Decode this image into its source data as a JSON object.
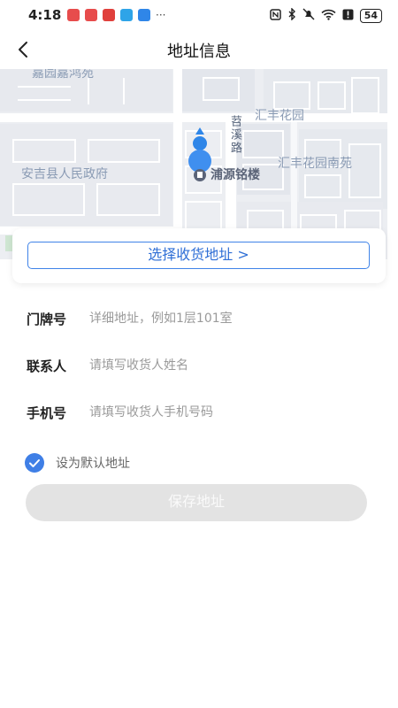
{
  "status_bar": {
    "time": "4:18",
    "more": "···",
    "battery": "54",
    "notif_colors": [
      "#e74c4c",
      "#e74c4c",
      "#e0403c",
      "#2ea4e8",
      "#2f86e8"
    ]
  },
  "header": {
    "title": "地址信息",
    "back_icon": "chevron-left-icon"
  },
  "map": {
    "labels": {
      "jiayuan": "嘉园嘉鸿苑",
      "huifeng": "汇丰花园",
      "huifeng_south": "汇丰花园南苑",
      "gov": "安吉县人民政府",
      "road": "苕溪路",
      "poi": "浦源铭楼"
    },
    "marker_color": "#2f86e8"
  },
  "select_address": {
    "label": "选择收货地址 >"
  },
  "form": {
    "door": {
      "label": "门牌号",
      "placeholder": "详细地址，例如1层101室",
      "value": ""
    },
    "contact": {
      "label": "联系人",
      "placeholder": "请填写收货人姓名",
      "value": ""
    },
    "phone": {
      "label": "手机号",
      "placeholder": "请填写收货人手机号码",
      "value": ""
    }
  },
  "default_address": {
    "label": "设为默认地址",
    "checked": true
  },
  "save": {
    "label": "保存地址"
  },
  "colors": {
    "accent": "#3f83e8",
    "save_disabled_bg": "#e3e3e3"
  }
}
